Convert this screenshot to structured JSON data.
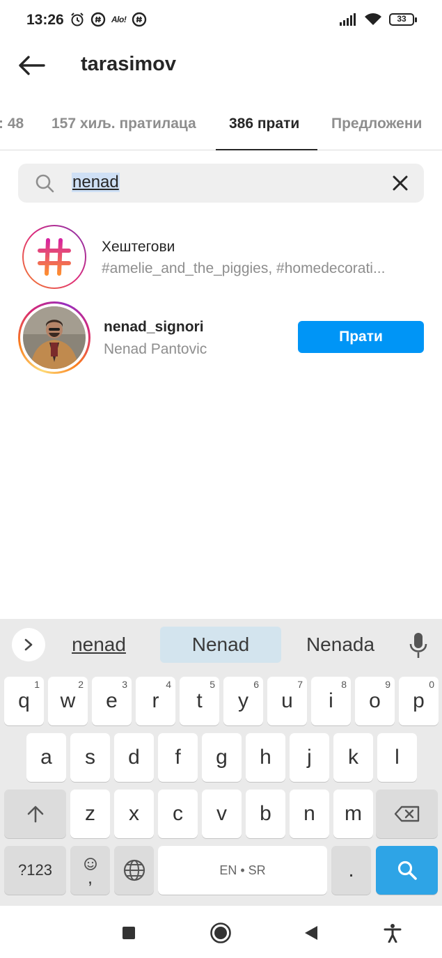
{
  "status": {
    "time": "13:26",
    "alo_label": "Alo!",
    "battery": "33"
  },
  "header": {
    "title": "tarasimov"
  },
  "tabs": [
    {
      "label": ": 48"
    },
    {
      "label": "157 хиљ. пратилаца"
    },
    {
      "label": "386 прати"
    },
    {
      "label": "Предложени"
    }
  ],
  "search": {
    "value": "nenad"
  },
  "results": {
    "hashtags": {
      "title": "Хештегови",
      "subtitle": "#amelie_and_the_piggies, #homedecorati..."
    },
    "user": {
      "username": "nenad_signori",
      "full_name": "Nenad Pantovic",
      "follow_label": "Прати"
    }
  },
  "keyboard": {
    "suggestions": [
      "nenad",
      "Nenad",
      "Nenada"
    ],
    "row1": [
      {
        "k": "q",
        "h": "1"
      },
      {
        "k": "w",
        "h": "2"
      },
      {
        "k": "e",
        "h": "3"
      },
      {
        "k": "r",
        "h": "4"
      },
      {
        "k": "t",
        "h": "5"
      },
      {
        "k": "y",
        "h": "6"
      },
      {
        "k": "u",
        "h": "7"
      },
      {
        "k": "i",
        "h": "8"
      },
      {
        "k": "o",
        "h": "9"
      },
      {
        "k": "p",
        "h": "0"
      }
    ],
    "row2": [
      "a",
      "s",
      "d",
      "f",
      "g",
      "h",
      "j",
      "k",
      "l"
    ],
    "row3": [
      "z",
      "x",
      "c",
      "v",
      "b",
      "n",
      "m"
    ],
    "symbols_label": "?123",
    "emoji_comma": ",",
    "space_label": "EN • SR",
    "period": "."
  },
  "icons": {
    "status": [
      "alarm-icon",
      "at-icon",
      "at-icon",
      "signal-icon",
      "wifi-icon",
      "battery-icon"
    ],
    "nav": [
      "recents-square-icon",
      "home-circle-icon",
      "back-triangle-icon",
      "accessibility-icon"
    ]
  },
  "colors": {
    "primary": "#0095f6",
    "search_key": "#2ea4e6",
    "muted_text": "#8e8e8e"
  }
}
